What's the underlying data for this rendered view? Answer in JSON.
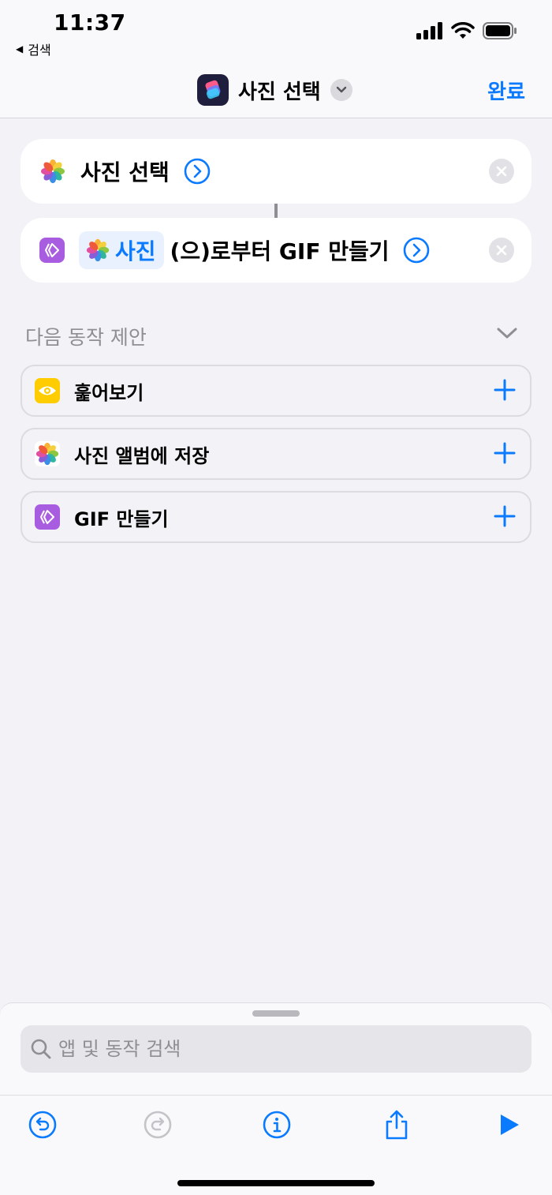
{
  "status": {
    "time": "11:37",
    "back_app": "검색"
  },
  "nav": {
    "title": "사진 선택",
    "done_label": "완료"
  },
  "actions": [
    {
      "text": "사진 선택"
    },
    {
      "token": "사진",
      "text": "(으)로부터 GIF 만들기"
    }
  ],
  "suggestions": {
    "header": "다음 동작 제안",
    "items": [
      {
        "label": "훑어보기",
        "icon": "eye-icon",
        "color": "#ffcc00"
      },
      {
        "label": "사진 앨범에 저장",
        "icon": "photos-icon"
      },
      {
        "label": "GIF 만들기",
        "icon": "gif-icon",
        "color": "#a85ce0"
      }
    ]
  },
  "search": {
    "placeholder": "앱 및 동작 검색"
  },
  "colors": {
    "accent": "#0a7aff",
    "background": "#f2f2f7"
  }
}
